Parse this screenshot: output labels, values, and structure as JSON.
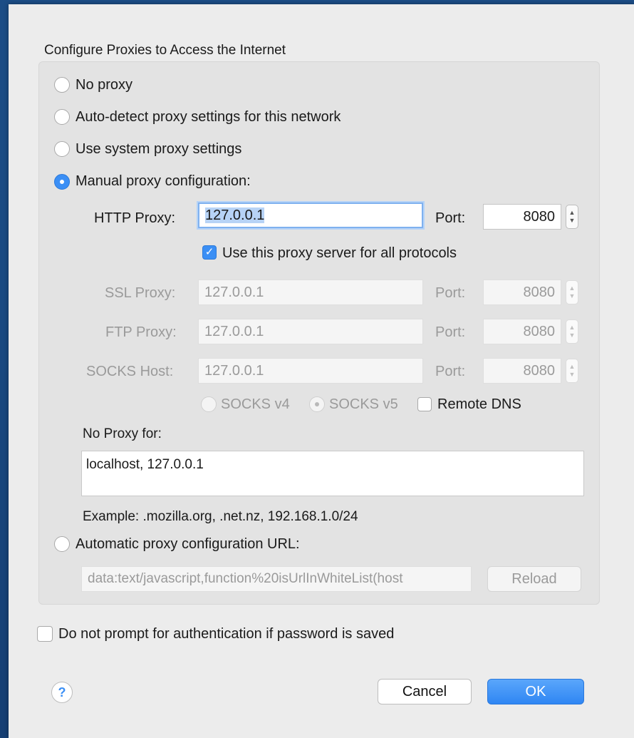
{
  "dialog": {
    "group_title": "Configure Proxies to Access the Internet",
    "options": {
      "no_proxy": "No proxy",
      "auto_detect": "Auto-detect proxy settings for this network",
      "system": "Use system proxy settings",
      "manual": "Manual proxy configuration:",
      "auto_url": "Automatic proxy configuration URL:"
    },
    "selected_option": "manual",
    "http": {
      "label": "HTTP Proxy:",
      "value": "127.0.0.1",
      "port_label": "Port:",
      "port": "8080"
    },
    "use_for_all": {
      "label": "Use this proxy server for all protocols",
      "checked": true
    },
    "ssl": {
      "label": "SSL Proxy:",
      "value": "127.0.0.1",
      "port_label": "Port:",
      "port": "8080"
    },
    "ftp": {
      "label": "FTP Proxy:",
      "value": "127.0.0.1",
      "port_label": "Port:",
      "port": "8080"
    },
    "socks": {
      "label": "SOCKS Host:",
      "value": "127.0.0.1",
      "port_label": "Port:",
      "port": "8080"
    },
    "socks_version": {
      "v4": "SOCKS v4",
      "v5": "SOCKS v5",
      "selected": "v5"
    },
    "remote_dns": {
      "label": "Remote DNS",
      "checked": false
    },
    "no_proxy_for": {
      "label": "No Proxy for:",
      "value": "localhost, 127.0.0.1",
      "example": "Example: .mozilla.org, .net.nz, 192.168.1.0/24"
    },
    "auto_url_value": "data:text/javascript,function%20isUrlInWhiteList(host",
    "reload_label": "Reload",
    "no_prompt_auth": {
      "label": "Do not prompt for authentication if password is saved",
      "checked": false
    },
    "help_label": "?",
    "cancel_label": "Cancel",
    "ok_label": "OK",
    "icons": {
      "stepper": "stepper-arrows-icon",
      "help": "help-icon",
      "check": "checkmark-icon"
    },
    "colors": {
      "accent": "#3b8ff5",
      "dialog_bg": "#ececec",
      "desktop": "#1c4d86"
    }
  }
}
